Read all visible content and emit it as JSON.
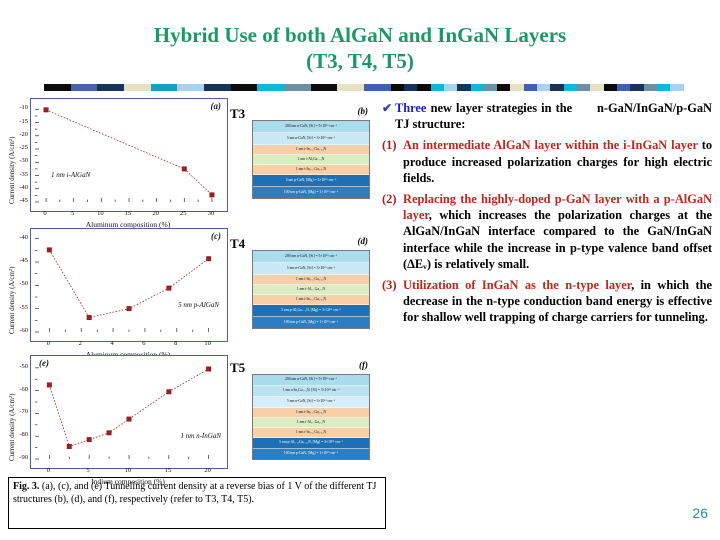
{
  "title": {
    "line1": "Hybrid Use of both AlGaN and InGaN Layers",
    "line2": "(T3, T4, T5)",
    "color": "#1a9966"
  },
  "rule_colors": [
    "#0b0b0b",
    "#0b0b0b",
    "#4a63a8",
    "#4a63a8",
    "#17335c",
    "#17335c",
    "#e6e0c4",
    "#e6e0c4",
    "#1b9fc0",
    "#1b9fc0",
    "#a8d2f0",
    "#a8d2f0",
    "#17335c",
    "#17335c",
    "#0b0b0b",
    "#0b0b0b",
    "#11b7d4",
    "#11b7d4",
    "#6f8fa3",
    "#6f8fa3",
    "#0b0b0b",
    "#0b0b0b",
    "#e6e0c4",
    "#e6e0c4",
    "#3f5fb0",
    "#3f5fb0",
    "#0b0b0b",
    "#17335c",
    "#0b0b0b",
    "#11b7d4",
    "#a8d2f0",
    "#17335c",
    "#11b7d4",
    "#6f8fa3",
    "#0b0b0b",
    "#e6e0c4",
    "#3f5fb0",
    "#a8d2f0",
    "#17335c",
    "#11b7d4",
    "#6f8fa3",
    "#e6e0c4",
    "#0b0b0b",
    "#3f5fb0",
    "#17335c",
    "#6f8fa3",
    "#11b7d4",
    "#a8d2f0"
  ],
  "charts": [
    {
      "id": "(a)",
      "note": "1 nm i-AlGaN",
      "xlabel": "Aluminum composition (%)",
      "ylabel": "Current density (A/cm²)",
      "xticks": [
        "0",
        "5",
        "10",
        "15",
        "20",
        "25",
        "30"
      ],
      "yticks": [
        "-10",
        "-15",
        "-20",
        "-25",
        "-30",
        "-35",
        "-40",
        "-45"
      ],
      "xlim": [
        -2,
        32
      ],
      "ylim": [
        -45,
        -8
      ],
      "points": [
        [
          0,
          -10.2
        ],
        [
          25,
          -32.5
        ],
        [
          30,
          -42.3
        ]
      ]
    },
    {
      "id": "(c)",
      "note": "5 nm p-AlGaN",
      "xlabel": "Aluminum composition (%)",
      "ylabel": "Current density (A/cm²)",
      "xticks": [
        "0",
        "2",
        "4",
        "6",
        "8",
        "10"
      ],
      "yticks": [
        "-40",
        "-45",
        "-50",
        "-55",
        "-60"
      ],
      "xlim": [
        -0.9,
        10.9
      ],
      "ylim": [
        -60,
        -39
      ],
      "points": [
        [
          0,
          -42.4
        ],
        [
          2.5,
          -56.9
        ],
        [
          5,
          -55.0
        ],
        [
          7.5,
          -50.6
        ],
        [
          10,
          -44.3
        ]
      ]
    },
    {
      "id": "(e)",
      "note": "1 nm n-InGaN",
      "xlabel": "Indium composition (%)",
      "ylabel": "Current density (A/cm²)",
      "xticks": [
        "0",
        "5",
        "10",
        "15",
        "20"
      ],
      "yticks": [
        "-50",
        "-60",
        "-70",
        "-80",
        "-90"
      ],
      "xlim": [
        -1.8,
        21.8
      ],
      "ylim": [
        -90,
        -47
      ],
      "points": [
        [
          0,
          -57.5
        ],
        [
          2.5,
          -84.5
        ],
        [
          5,
          -81.5
        ],
        [
          7.5,
          -78.5
        ],
        [
          10,
          -72.5
        ],
        [
          15,
          -60.5
        ],
        [
          20,
          -50.5
        ]
      ]
    }
  ],
  "stacks": [
    {
      "label": "T3",
      "id": "(b)",
      "layers": [
        {
          "text": "200 nm n-GaN, [Si] = 5×10¹⁹ cm⁻³",
          "color": "#a9dced",
          "dark": false,
          "h": 11
        },
        {
          "text": "5 nm n-GaN, [Si] = 3×10¹⁹ cm⁻³",
          "color": "#c9e9f6",
          "dark": false,
          "h": 11
        },
        {
          "text": "1 nm i-In₀.₁₁Ga₀.₈₉N",
          "color": "#f7cfa8",
          "dark": false,
          "h": 9
        },
        {
          "text": "1 nm i-AlₓGa₁₋ₓN",
          "color": "#dbedc2",
          "dark": false,
          "h": 9
        },
        {
          "text": "1 nm i-In₀.₁₁Ga₀.₈₉N",
          "color": "#f7cfa8",
          "dark": false,
          "h": 9
        },
        {
          "text": "5 nm p-GaN, [Mg] = 3×10²⁰ cm⁻³",
          "color": "#1f6fb5",
          "dark": true,
          "h": 11
        },
        {
          "text": "100 nm p-GaN, [Mg] = 1×10²⁰ cm⁻³",
          "color": "#2e7dc0",
          "dark": true,
          "h": 11
        }
      ]
    },
    {
      "label": "T4",
      "id": "(d)",
      "layers": [
        {
          "text": "200 nm n-GaN, [Si] = 5×10¹⁹ cm⁻³",
          "color": "#a9dced",
          "dark": false,
          "h": 11
        },
        {
          "text": "5 nm n-GaN, [Si] = 3×10¹⁹ cm⁻³",
          "color": "#c9e9f6",
          "dark": false,
          "h": 11
        },
        {
          "text": "1 nm i-In₀.₁₁Ga₀.₈₉N",
          "color": "#f7cfa8",
          "dark": false,
          "h": 9
        },
        {
          "text": "1 nm i-Al₀.₁Ga₀.₉N",
          "color": "#dbedc2",
          "dark": false,
          "h": 9
        },
        {
          "text": "1 nm i-In₀.₁₁Ga₀.₈₉N",
          "color": "#f7cfa8",
          "dark": false,
          "h": 9
        },
        {
          "text": "5 nm p-AlₓGa₁₋ₓN, [Mg] = 3×10²⁰ cm⁻³",
          "color": "#1f6fb5",
          "dark": true,
          "h": 11
        },
        {
          "text": "100 nm p-GaN, [Mg] = 1×10²⁰ cm⁻³",
          "color": "#2e7dc0",
          "dark": true,
          "h": 11
        }
      ]
    },
    {
      "label": "T5",
      "id": "(f)",
      "layers": [
        {
          "text": "200 nm n-GaN, [Si] = 5×10¹⁹ cm⁻³",
          "color": "#a9dced",
          "dark": false,
          "h": 10
        },
        {
          "text": "1 nm n-InₓGa₁₋ₓN, [Si] = 3×10¹⁹ cm⁻³",
          "color": "#bde3f3",
          "dark": false,
          "h": 10
        },
        {
          "text": "5 nm n-GaN, [Si] = 3×10¹⁹ cm⁻³",
          "color": "#d6eefa",
          "dark": false,
          "h": 10
        },
        {
          "text": "1 nm i-In₀.₁₁Ga₀.₈₉N",
          "color": "#f7cfa8",
          "dark": false,
          "h": 9
        },
        {
          "text": "1 nm i-Al₀.₁Ga₀.₉N",
          "color": "#dbedc2",
          "dark": false,
          "h": 9
        },
        {
          "text": "1 nm i-In₀.₁₁Ga₀.₈₉N",
          "color": "#f7cfa8",
          "dark": false,
          "h": 9
        },
        {
          "text": "5 nm p-Al₀.₁₀Ga₀.₉₀N, [Mg] = 3×10²⁰ cm⁻³",
          "color": "#1f6fb5",
          "dark": true,
          "h": 10
        },
        {
          "text": "100 nm p-GaN, [Mg] = 1×10²⁰ cm⁻³",
          "color": "#2e7dc0",
          "dark": true,
          "h": 10
        }
      ]
    }
  ],
  "caption": {
    "lead": "Fig. 3.",
    "text": " (a), (c), and (e) Tunneling current density at a reverse bias of 1 V of the different TJ structures (b), (d), and (f), respectively (refer to T3, T4, T5)."
  },
  "bullets": {
    "check_mark": "✔",
    "intro_blue": "Three",
    "intro_rest": " new layer strategies in the      n-GaN/InGaN/p-GaN TJ structure:",
    "items": [
      {
        "num": "(1)",
        "red": "An intermediate AlGaN layer within the i-InGaN layer",
        "black": " to produce increased polarization charges for high electric fields."
      },
      {
        "num": "(2)",
        "red": "Replacing the highly-doped p-GaN layer with a p-AlGaN layer",
        "black": ", which increases the polarization charges at the AlGaN/InGaN interface compared to the GaN/InGaN interface while the increase in p-type valence band offset (ΔEᵥ) is relatively small."
      },
      {
        "num": "(3)",
        "red": "Utilization of InGaN as the n-type layer",
        "black": ", in which the decrease in the n-type conduction band energy is effective for shallow well trapping of charge carriers for tunneling."
      }
    ]
  },
  "page_number": "26"
}
